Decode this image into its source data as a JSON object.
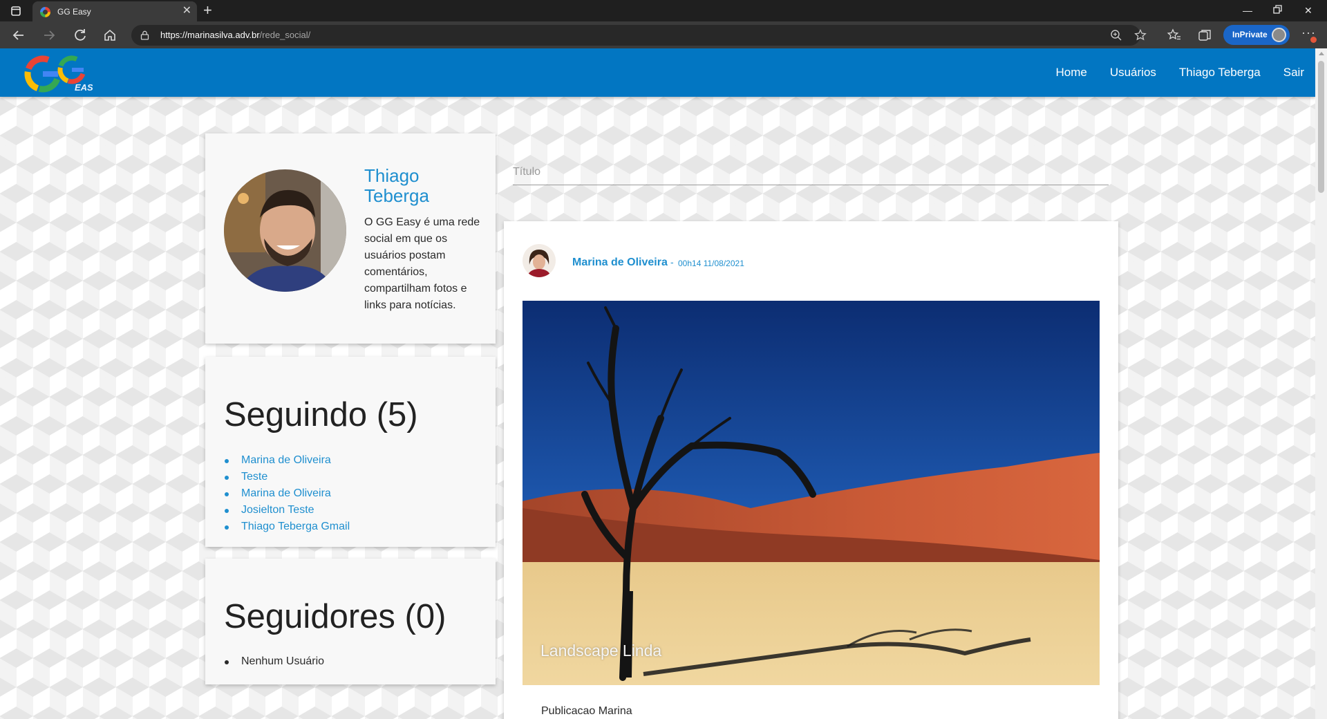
{
  "browser": {
    "tab_title": "GG Easy",
    "url_host": "https://marinasilva.adv.br",
    "url_path": "/rede_social/",
    "inprivate_label": "InPrivate"
  },
  "site": {
    "logo_text": "GG",
    "logo_sub": "EASY",
    "nav": [
      "Home",
      "Usuários",
      "Thiago Teberga",
      "Sair"
    ]
  },
  "profile": {
    "name": "Thiago Teberga",
    "description": "O GG Easy é uma rede social em que os usuários postam comentários, compartilham fotos e links para notícias."
  },
  "following": {
    "heading": "Seguindo (5)",
    "users": [
      "Marina de Oliveira",
      "Teste",
      "Marina de Oliveira",
      "Josielton Teste",
      "Thiago Teberga Gmail"
    ]
  },
  "followers": {
    "heading": "Seguidores (0)",
    "users": [
      "Nenhum Usuário"
    ]
  },
  "composer": {
    "title_placeholder": "Título"
  },
  "post": {
    "author": "Marina de Oliveira",
    "separator": "-",
    "time": "00h14 11/08/2021",
    "image_caption": "Landscape Linda",
    "text": "Publicacao Marina"
  },
  "colors": {
    "brand": "#0276c2",
    "link": "#1f8fcf"
  }
}
